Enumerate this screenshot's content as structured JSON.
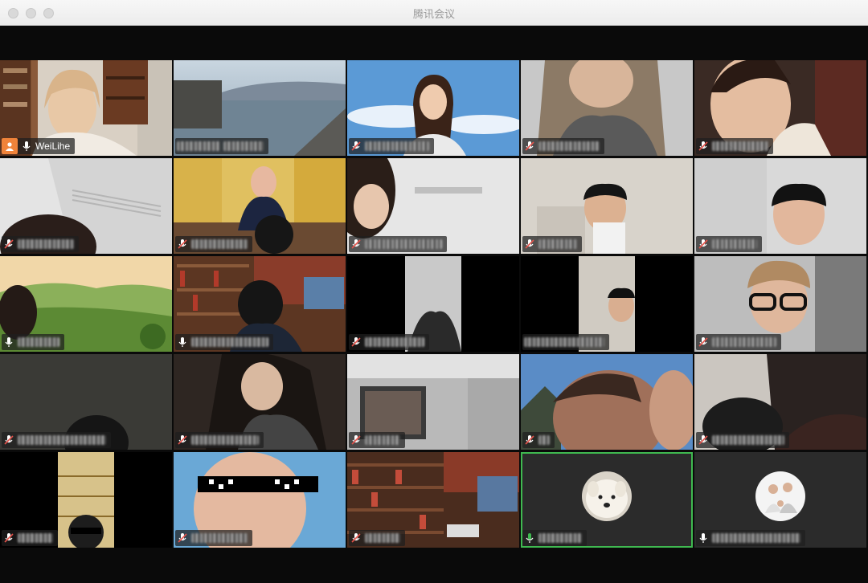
{
  "window": {
    "title": "腾讯会议"
  },
  "host": {
    "name": "WeiLihe"
  },
  "participants_visible": 25,
  "colors": {
    "host_badge": "#f0833a",
    "active_speaker": "#3fb950",
    "muted_mic": "#e5534b"
  },
  "icons": [
    "close-icon",
    "minimize-icon",
    "maximize-icon",
    "host-icon",
    "mic-icon",
    "mic-muted-icon",
    "mic-active-icon"
  ]
}
